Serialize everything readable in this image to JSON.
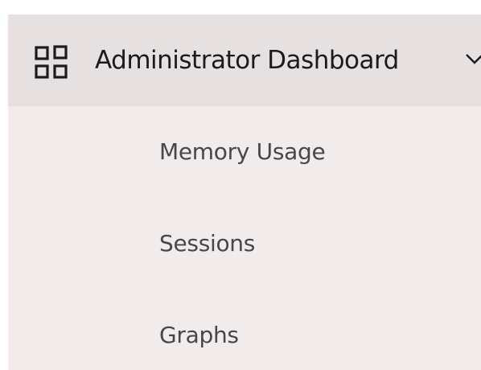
{
  "nav": {
    "header": {
      "label": "Administrator Dashboard",
      "icon": "dashboard-grid-icon",
      "expand_icon": "chevron-down-icon",
      "expanded": true
    },
    "items": [
      {
        "label": "Memory Usage"
      },
      {
        "label": "Sessions"
      },
      {
        "label": "Graphs"
      }
    ]
  },
  "colors": {
    "header_bg": "#e6e0e0",
    "panel_bg": "#f1ebeb",
    "header_text": "#1b1b1b",
    "item_text": "#4a4648"
  }
}
